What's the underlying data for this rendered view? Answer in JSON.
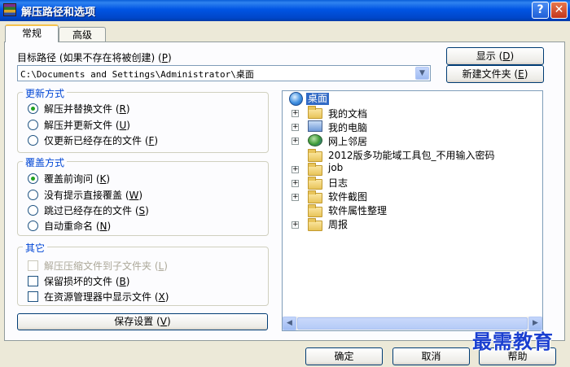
{
  "window": {
    "title": "解压路径和选项",
    "help_glyph": "?",
    "close_glyph": "✕"
  },
  "tabs": [
    {
      "label": "常规"
    },
    {
      "label": "高级"
    }
  ],
  "path": {
    "label": "目标路径 (如果不存在将被创建) (",
    "label_key": "P",
    "label_end": ")",
    "value": "C:\\Documents and Settings\\Administrator\\桌面"
  },
  "buttons": {
    "show": {
      "text": "显示 (",
      "key": "D",
      "end": ")"
    },
    "new_folder": {
      "text": "新建文件夹 (",
      "key": "E",
      "end": ")"
    },
    "save": {
      "text": "保存设置 (",
      "key": "V",
      "end": ")"
    },
    "ok": "确定",
    "cancel": "取消",
    "help": "帮助"
  },
  "update_mode": {
    "title": "更新方式",
    "options": [
      {
        "text": "解压并替换文件 (",
        "key": "R",
        "end": ")",
        "selected": true
      },
      {
        "text": "解压并更新文件 (",
        "key": "U",
        "end": ")",
        "selected": false
      },
      {
        "text": "仅更新已经存在的文件 (",
        "key": "F",
        "end": ")",
        "selected": false
      }
    ]
  },
  "overwrite_mode": {
    "title": "覆盖方式",
    "options": [
      {
        "text": "覆盖前询问 (",
        "key": "K",
        "end": ")",
        "selected": true
      },
      {
        "text": "没有提示直接覆盖 (",
        "key": "W",
        "end": ")",
        "selected": false
      },
      {
        "text": "跳过已经存在的文件 (",
        "key": "S",
        "end": ")",
        "selected": false
      },
      {
        "text": "自动重命名 (",
        "key": "N",
        "end": ")",
        "selected": false
      }
    ]
  },
  "other": {
    "title": "其它",
    "options": [
      {
        "text": "解压压缩文件到子文件夹 (",
        "key": "L",
        "end": ")",
        "checked": false,
        "disabled": true
      },
      {
        "text": "保留损坏的文件 (",
        "key": "B",
        "end": ")",
        "checked": false,
        "disabled": false
      },
      {
        "text": "在资源管理器中显示文件 (",
        "key": "X",
        "end": ")",
        "checked": false,
        "disabled": false
      }
    ]
  },
  "tree": {
    "root": "桌面",
    "items": [
      {
        "label": "我的文档",
        "icon": "my-documents-icon",
        "expandable": true
      },
      {
        "label": "我的电脑",
        "icon": "my-computer-icon",
        "expandable": true
      },
      {
        "label": "网上邻居",
        "icon": "network-places-icon",
        "expandable": true
      },
      {
        "label": "2012版多功能域工具包_不用输入密码",
        "icon": "folder-icon",
        "expandable": false
      },
      {
        "label": "job",
        "icon": "folder-icon",
        "expandable": true
      },
      {
        "label": "日志",
        "icon": "folder-icon",
        "expandable": true
      },
      {
        "label": "软件截图",
        "icon": "folder-icon",
        "expandable": true
      },
      {
        "label": "软件属性整理",
        "icon": "folder-icon",
        "expandable": false
      },
      {
        "label": "周报",
        "icon": "folder-icon",
        "expandable": true
      }
    ]
  },
  "watermark": "最需教育"
}
